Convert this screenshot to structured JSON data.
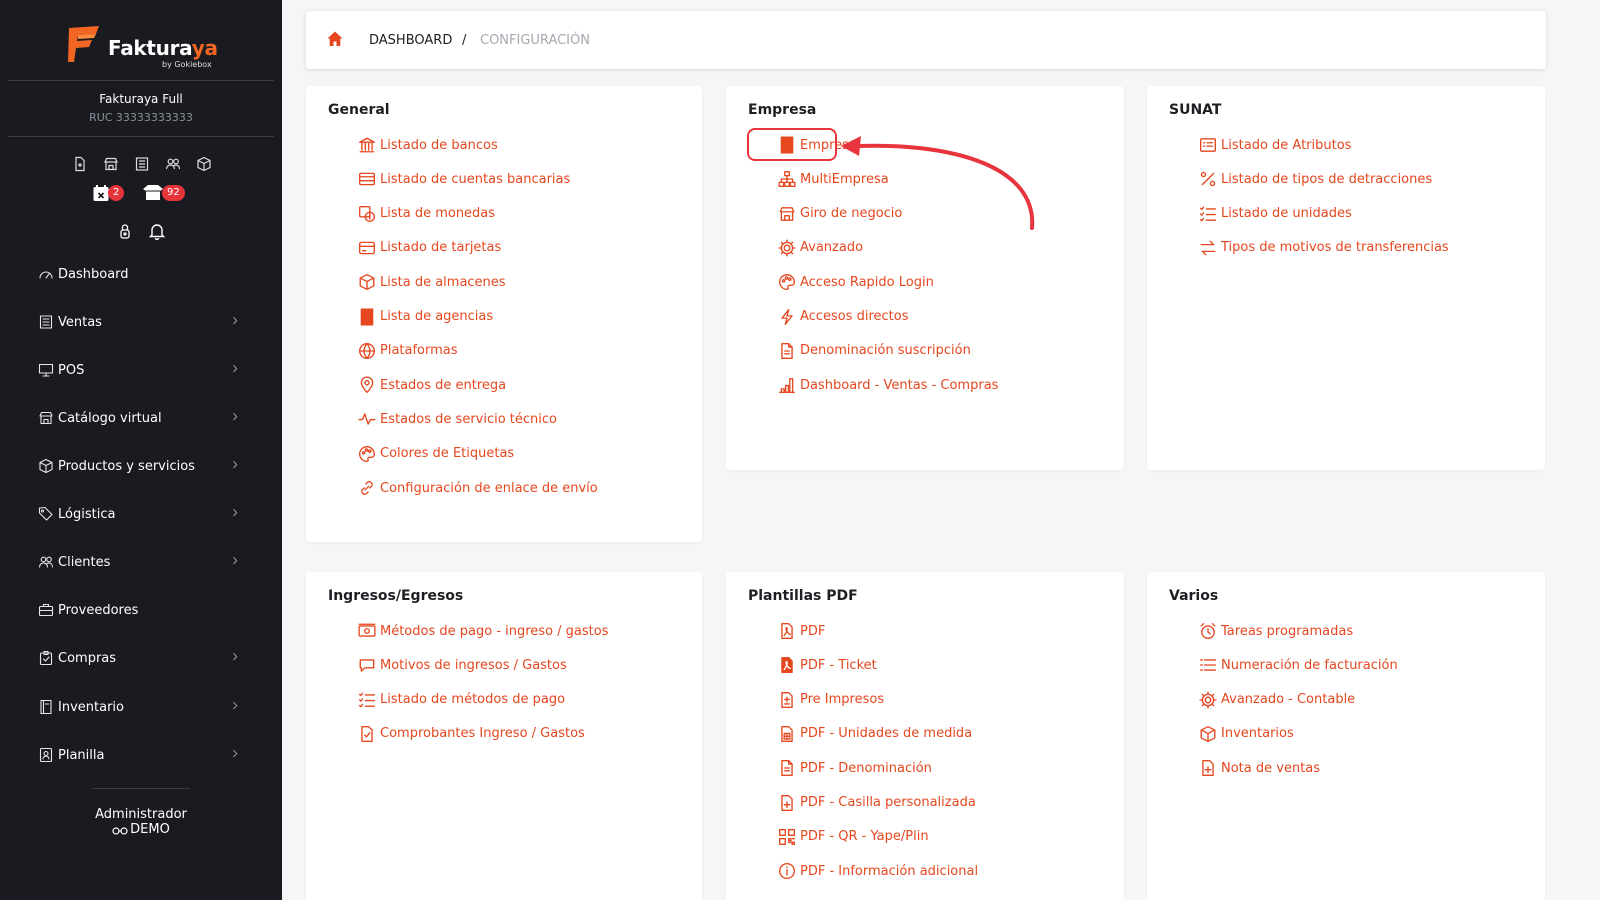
{
  "brand": {
    "name_main": "Faktura",
    "name_accent": "ya",
    "by": "by Gokiebox",
    "accent": "#f26522"
  },
  "company": {
    "name": "Fakturaya Full",
    "ruc": "RUC 33333333333"
  },
  "quick_icons": [
    "document-plus-icon",
    "store-icon",
    "receipt-icon",
    "users-icon",
    "box-icon"
  ],
  "badges": [
    {
      "icon": "calendar-x-icon",
      "count": "2"
    },
    {
      "icon": "package-icon",
      "count": "92"
    }
  ],
  "sidebar_menu": [
    {
      "label": "Dashboard",
      "icon": "gauge-icon",
      "chevron": false
    },
    {
      "label": "Ventas",
      "icon": "receipt-icon",
      "chevron": true
    },
    {
      "label": "POS",
      "icon": "monitor-icon",
      "chevron": true
    },
    {
      "label": "Catálogo virtual",
      "icon": "store-icon",
      "chevron": true
    },
    {
      "label": "Productos y servicios",
      "icon": "box-icon",
      "chevron": true
    },
    {
      "label": "Lógistica",
      "icon": "tag-icon",
      "chevron": true
    },
    {
      "label": "Clientes",
      "icon": "users-icon",
      "chevron": true
    },
    {
      "label": "Proveedores",
      "icon": "briefcase-icon",
      "chevron": false
    },
    {
      "label": "Compras",
      "icon": "clipboard-check-icon",
      "chevron": true
    },
    {
      "label": "Inventario",
      "icon": "book-icon",
      "chevron": true
    },
    {
      "label": "Planilla",
      "icon": "id-card-icon",
      "chevron": true
    }
  ],
  "user": {
    "name": "Administrador",
    "role": "DEMO"
  },
  "breadcrumb": {
    "home": "home-icon",
    "current": "DASHBOARD",
    "separator": "/",
    "section": "CONFIGURACIÓN"
  },
  "sections": [
    {
      "title": "General",
      "links": [
        {
          "label": "Listado de bancos",
          "icon": "bank-icon"
        },
        {
          "label": "Listado de cuentas bancarias",
          "icon": "credit-card-icon"
        },
        {
          "label": "Lista de monedas",
          "icon": "currency-icon"
        },
        {
          "label": "Listado de tarjetas",
          "icon": "card-icon"
        },
        {
          "label": "Lista de almacenes",
          "icon": "box-icon"
        },
        {
          "label": "Lista de agencias",
          "icon": "building-icon"
        },
        {
          "label": "Plataformas",
          "icon": "globe-icon"
        },
        {
          "label": "Estados de entrega",
          "icon": "map-pin-icon"
        },
        {
          "label": "Estados de servicio técnico",
          "icon": "activity-icon"
        },
        {
          "label": "Colores de Etiquetas",
          "icon": "palette-icon"
        },
        {
          "label": "Configuración de enlace de envío",
          "icon": "link-icon"
        }
      ]
    },
    {
      "title": "Empresa",
      "links": [
        {
          "label": "Empresa",
          "icon": "building-icon"
        },
        {
          "label": "MultiEmpresa",
          "icon": "sitemap-icon"
        },
        {
          "label": "Giro de negocio",
          "icon": "store-icon"
        },
        {
          "label": "Avanzado",
          "icon": "gear-icon"
        },
        {
          "label": "Acceso Rapido Login",
          "icon": "palette-icon"
        },
        {
          "label": "Accesos directos",
          "icon": "bolt-icon"
        },
        {
          "label": "Denominación suscripción",
          "icon": "file-text-icon"
        },
        {
          "label": "Dashboard - Ventas - Compras",
          "icon": "bar-chart-icon"
        }
      ]
    },
    {
      "title": "SUNAT",
      "links": [
        {
          "label": "Listado de Atributos",
          "icon": "list-box-icon"
        },
        {
          "label": "Listado de tipos de detracciones",
          "icon": "percent-icon"
        },
        {
          "label": "Listado de unidades",
          "icon": "list-check-icon"
        },
        {
          "label": "Tipos de motivos de transferencias",
          "icon": "transfer-icon"
        }
      ]
    },
    {
      "title": "Ingresos/Egresos",
      "links": [
        {
          "label": "Métodos de pago - ingreso / gastos",
          "icon": "cash-icon"
        },
        {
          "label": "Motivos de ingresos / Gastos",
          "icon": "chat-icon"
        },
        {
          "label": "Listado de métodos de pago",
          "icon": "list-check-icon"
        },
        {
          "label": "Comprobantes Ingreso / Gastos",
          "icon": "file-check-icon"
        }
      ]
    },
    {
      "title": "Plantillas PDF",
      "links": [
        {
          "label": "PDF",
          "icon": "file-pdf-icon"
        },
        {
          "label": "PDF - Ticket",
          "icon": "file-pdf-solid-icon"
        },
        {
          "label": "Pre Impresos",
          "icon": "file-plus-minus-icon"
        },
        {
          "label": "PDF - Unidades de medida",
          "icon": "file-grid-icon"
        },
        {
          "label": "PDF - Denominación",
          "icon": "file-text-icon"
        },
        {
          "label": "PDF - Casilla personalizada",
          "icon": "file-plus-icon"
        },
        {
          "label": "PDF - QR - Yape/Plin",
          "icon": "qr-icon"
        },
        {
          "label": "PDF - Información adicional",
          "icon": "info-icon"
        }
      ]
    },
    {
      "title": "Varios",
      "links": [
        {
          "label": "Tareas programadas",
          "icon": "alarm-icon"
        },
        {
          "label": "Numeración de facturación",
          "icon": "list-icon"
        },
        {
          "label": "Avanzado - Contable",
          "icon": "gear-icon"
        },
        {
          "label": "Inventarios",
          "icon": "box-icon"
        },
        {
          "label": "Nota de ventas",
          "icon": "file-plus-icon"
        }
      ]
    }
  ],
  "annotation": {
    "highlight_color": "#e8353d",
    "target": "Empresa"
  },
  "colors": {
    "sidebar_bg": "#191b20",
    "link": "#e5471e",
    "page_bg": "#f5f6f8"
  }
}
